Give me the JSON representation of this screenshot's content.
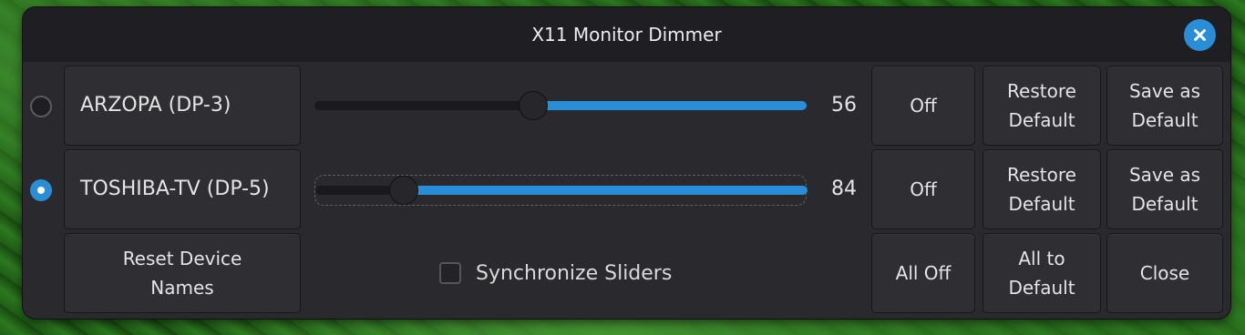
{
  "window": {
    "title": "X11 Monitor Dimmer",
    "close_icon": "close-icon"
  },
  "devices": [
    {
      "name": "ARZOPA (DP-3)",
      "brightness": 56,
      "slider_fraction": 0.56,
      "selected": false,
      "off_label": "Off",
      "restore_label": "Restore\nDefault",
      "save_label": "Save as\nDefault"
    },
    {
      "name": "TOSHIBA-TV (DP-5)",
      "brightness": 84,
      "slider_fraction": 0.84,
      "selected": true,
      "off_label": "Off",
      "restore_label": "Restore\nDefault",
      "save_label": "Save as\nDefault"
    }
  ],
  "footer": {
    "reset_label": "Reset Device\nNames",
    "sync_label": "Synchronize Sliders",
    "sync_checked": false,
    "all_off_label": "All Off",
    "all_default_label": "All to\nDefault",
    "close_label": "Close"
  },
  "colors": {
    "accent": "#2a8ed6",
    "window_bg": "#2a2a2e",
    "titlebar_bg": "#1f1f23"
  }
}
